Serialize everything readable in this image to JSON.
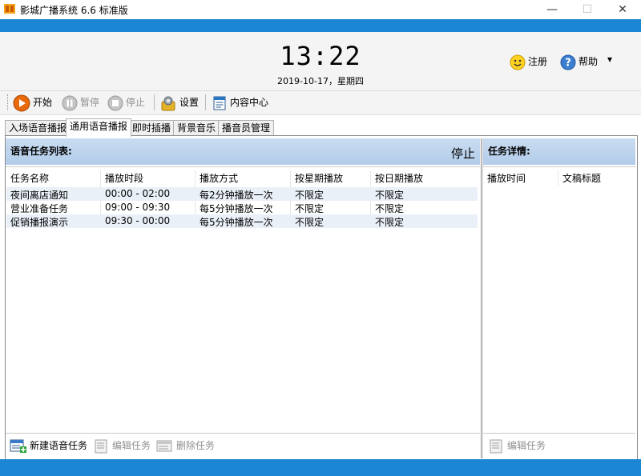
{
  "window": {
    "title": "影城广播系统 6.6 标准版",
    "minimize_glyph": "—",
    "maximize_glyph": "☐",
    "close_glyph": "✕"
  },
  "header": {
    "clock": "13:22",
    "date": "2019-10-17，星期四",
    "register_label": "注册",
    "help_label": "帮助",
    "menu_glyph": "▾"
  },
  "toolbar": {
    "start_label": "开始",
    "pause_label": "暂停",
    "stop_label": "停止",
    "settings_label": "设置",
    "content_center_label": "内容中心"
  },
  "tabs": [
    {
      "label": "入场语音播报",
      "active": false
    },
    {
      "label": "通用语音播报",
      "active": true
    },
    {
      "label": "即时插播",
      "active": false
    },
    {
      "label": "背景音乐",
      "active": false
    },
    {
      "label": "播音员管理",
      "active": false
    }
  ],
  "task_list": {
    "title": "语音任务列表:",
    "status": "停止",
    "columns": [
      "任务名称",
      "播放时段",
      "播放方式",
      "按星期播放",
      "按日期播放"
    ],
    "rows": [
      [
        "夜间离店通知",
        "00:00 - 02:00",
        "每2分钟播放一次",
        "不限定",
        "不限定"
      ],
      [
        "营业准备任务",
        "09:00 - 09:30",
        "每5分钟播放一次",
        "不限定",
        "不限定"
      ],
      [
        "促销播报演示",
        "09:30 - 00:00",
        "每5分钟播放一次",
        "不限定",
        "不限定"
      ]
    ],
    "new_task_label": "新建语音任务",
    "edit_task_label": "编辑任务",
    "delete_task_label": "删除任务"
  },
  "task_detail": {
    "title": "任务详情:",
    "columns": [
      "播放时间",
      "文稿标题"
    ],
    "edit_task_label": "编辑任务"
  },
  "colors": {
    "accent_blue": "#1b86d4",
    "section_header": "#c9dcf1",
    "alt_row": "#e9f0f7"
  }
}
